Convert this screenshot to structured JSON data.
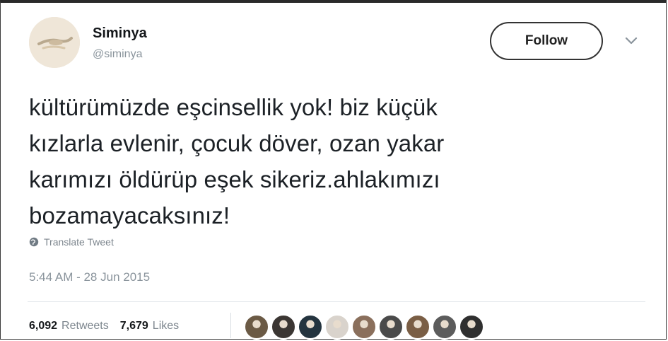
{
  "user": {
    "display_name": "Siminya",
    "handle": "@siminya"
  },
  "follow_button": {
    "label": "Follow"
  },
  "tweet": {
    "lines": [
      "kültürümüzde eşcinsellik yok! biz küçük",
      "kızlarla evlenir, çocuk döver, ozan yakar",
      "karımızı öldürüp eşek sikeriz.ahlakımızı",
      "bozamayacaksınız!"
    ]
  },
  "translate": {
    "label": "Translate Tweet",
    "icon": "globe-icon"
  },
  "timestamp": "5:44 AM - 28 Jun 2015",
  "stats": {
    "retweets_count": "6,092",
    "retweets_label": "Retweets",
    "likes_count": "7,679",
    "likes_label": "Likes"
  },
  "likers": [
    {
      "color": "#6b5a45"
    },
    {
      "color": "#3b3633"
    },
    {
      "color": "#24343f"
    },
    {
      "color": "#d9d3cc"
    },
    {
      "color": "#8a6f5c"
    },
    {
      "color": "#4a4a4a"
    },
    {
      "color": "#7a5e45"
    },
    {
      "color": "#5c5c5c"
    },
    {
      "color": "#2f2f2f"
    }
  ]
}
